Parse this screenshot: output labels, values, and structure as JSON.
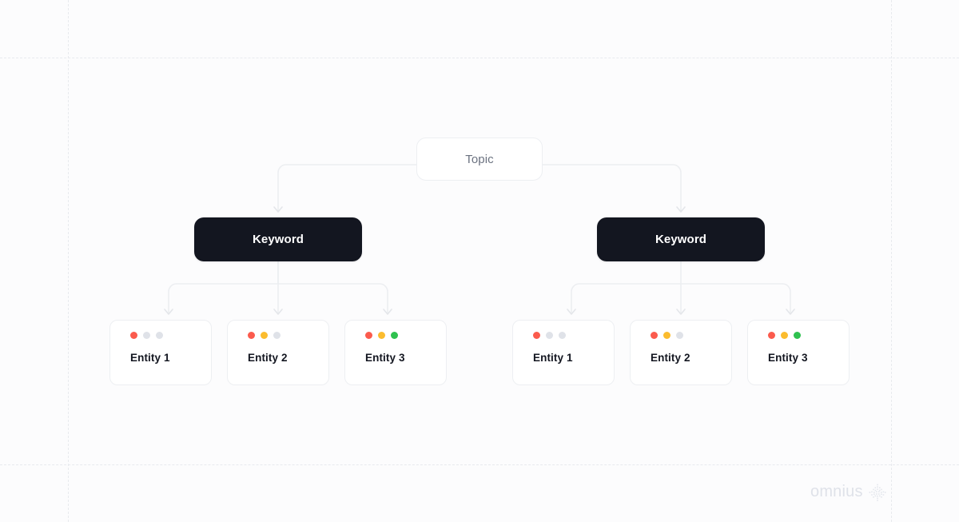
{
  "canvas": {
    "background_color": "#fcfcfd",
    "grid": {
      "line_color": "#e8eaee",
      "style": "dashed",
      "vertical_x": [
        85,
        1115
      ],
      "horizontal_y": [
        72,
        581
      ]
    }
  },
  "diagram": {
    "type": "hierarchy-tree",
    "root": {
      "label": "Topic",
      "shape": "rounded-rect",
      "background_color": "#ffffff",
      "border_color": "#edeff2",
      "text_color": "#6b7280"
    },
    "branches": [
      {
        "keyword": {
          "label": "Keyword",
          "background_color": "#131620",
          "text_color": "#ffffff"
        },
        "entities": [
          {
            "label": "Entity 1",
            "dots": [
              "#fb5b4d",
              "#dfe2e8",
              "#dfe2e8"
            ]
          },
          {
            "label": "Entity 2",
            "dots": [
              "#fb5b4d",
              "#fbbc2e",
              "#dfe2e8"
            ]
          },
          {
            "label": "Entity 3",
            "dots": [
              "#fb5b4d",
              "#fbbc2e",
              "#2fc14f"
            ]
          }
        ]
      },
      {
        "keyword": {
          "label": "Keyword",
          "background_color": "#131620",
          "text_color": "#ffffff"
        },
        "entities": [
          {
            "label": "Entity 1",
            "dots": [
              "#fb5b4d",
              "#dfe2e8",
              "#dfe2e8"
            ]
          },
          {
            "label": "Entity 2",
            "dots": [
              "#fb5b4d",
              "#fbbc2e",
              "#dfe2e8"
            ]
          },
          {
            "label": "Entity 3",
            "dots": [
              "#fb5b4d",
              "#fbbc2e",
              "#2fc14f"
            ]
          }
        ]
      }
    ],
    "connector_color": "#eceef1"
  },
  "watermark": {
    "text": "omnius",
    "text_color": "#dfe2e9",
    "mark_color": "#e4e7ed"
  }
}
